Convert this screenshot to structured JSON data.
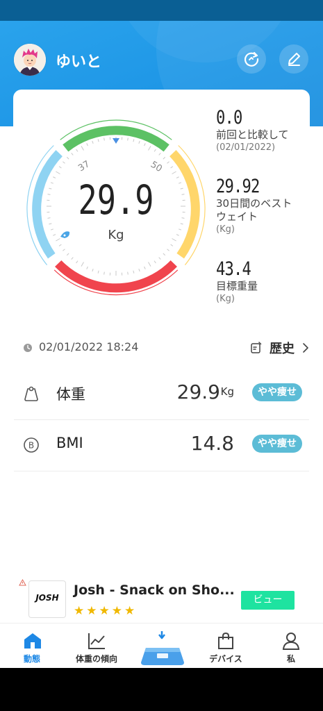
{
  "header": {
    "username": "ゆいと"
  },
  "gauge": {
    "value": "29.9",
    "unit": "Kg",
    "tick_low": "37",
    "tick_high": "50"
  },
  "stats": [
    {
      "value": "0.0",
      "label": "前回と比較して",
      "sub": "(02/01/2022)"
    },
    {
      "value": "29.92",
      "label_line1": "30日間のベスト",
      "label_line2": "ウェイト",
      "sub": "(Kg)"
    },
    {
      "value": "43.4",
      "label": "目標重量",
      "sub": "(Kg)"
    }
  ],
  "measurement": {
    "datetime": "02/01/2022 18:24",
    "history_label": "歴史"
  },
  "rows": [
    {
      "label": "体重",
      "value": "29.9",
      "unit": "Kg",
      "status": "やや痩せ"
    },
    {
      "label": "BMI",
      "value": "14.8",
      "unit": "",
      "status": "やや痩せ"
    }
  ],
  "ad": {
    "brand": "JOSH",
    "title": "Josh - Snack on Sho...",
    "rating": 5,
    "stars": "★★★★★",
    "button": "ビュー"
  },
  "tabs": [
    {
      "label": "動態",
      "active": true
    },
    {
      "label": "体重の傾向",
      "active": false
    },
    {
      "label": "",
      "active": false
    },
    {
      "label": "デバイス",
      "active": false
    },
    {
      "label": "私",
      "active": false
    }
  ],
  "colors": {
    "header": "#1e96e6",
    "gauge_green": "#5cc164",
    "gauge_yellow": "#ffd66b",
    "gauge_red": "#f0444d",
    "gauge_blue": "#8fd3f2",
    "status_pill": "#5cbcd6",
    "ad_button": "#1ee3a0",
    "tab_active": "#1e88e5"
  }
}
